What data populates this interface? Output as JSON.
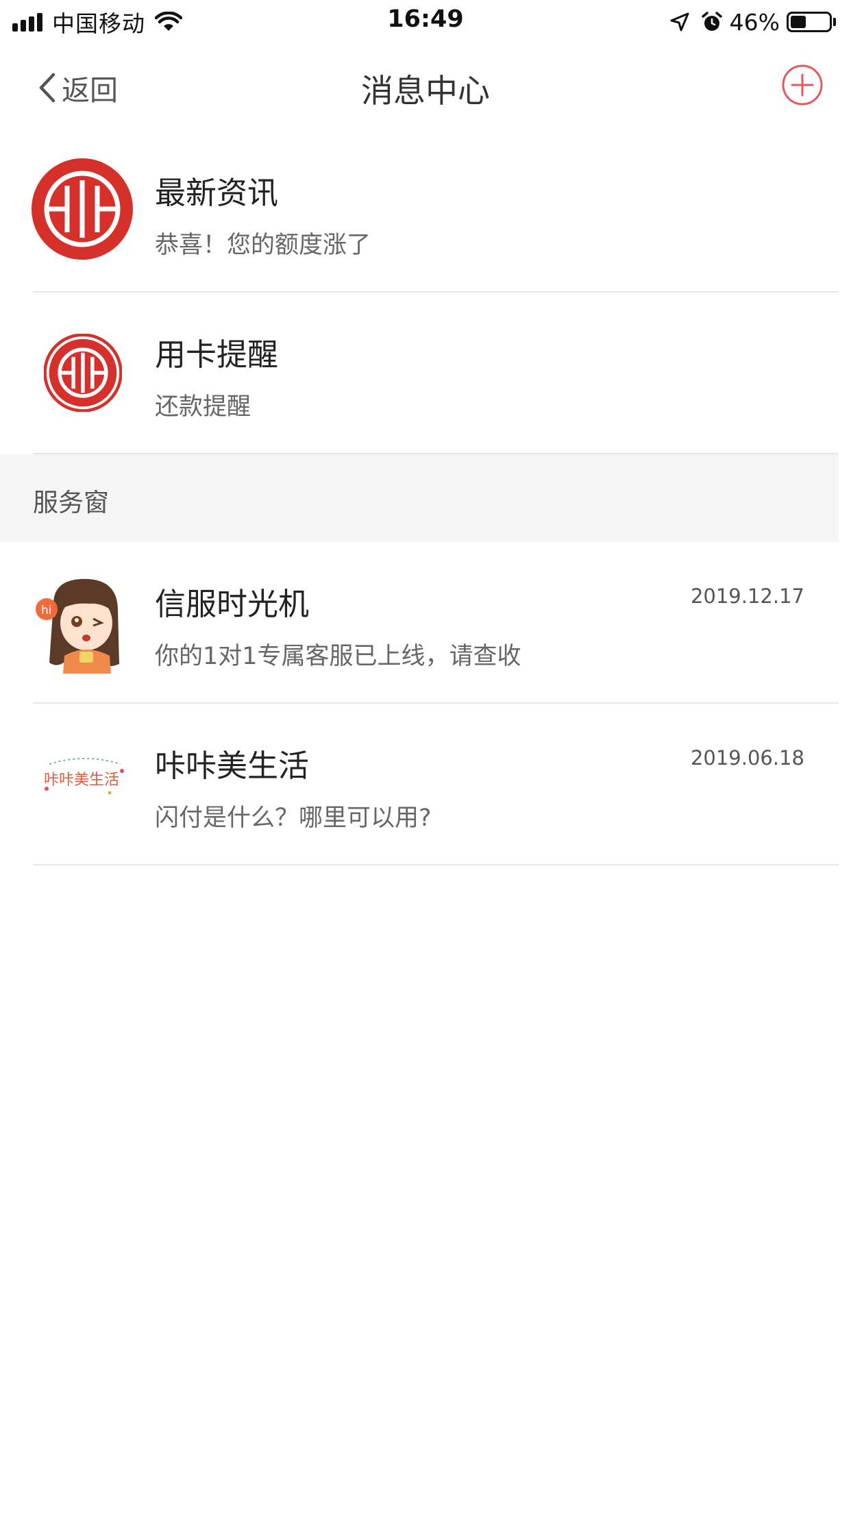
{
  "status_bar": {
    "carrier": "中国移动",
    "time": "16:49",
    "battery_percent": "46%",
    "battery_level": 0.46
  },
  "nav": {
    "back_label": "返回",
    "title": "消息中心"
  },
  "messages": [
    {
      "title": "最新资讯",
      "subtitle": "恭喜！您的额度涨了",
      "date": ""
    },
    {
      "title": "用卡提醒",
      "subtitle": "还款提醒",
      "date": ""
    }
  ],
  "section": {
    "label": "服务窗"
  },
  "services": [
    {
      "title": "信服时光机",
      "subtitle": "你的1对1专属客服已上线，请查收",
      "date": "2019.12.17",
      "badge": "hi"
    },
    {
      "title": "咔咔美生活",
      "subtitle": "闪付是什么？哪里可以用?",
      "date": "2019.06.18",
      "logo_text": "咔咔美生活"
    }
  ],
  "colors": {
    "brand_red": "#d6302a",
    "accent_add": "#e8585a",
    "section_bg": "#f5f5f5"
  },
  "icons": {
    "back": "chevron-left-icon",
    "add": "plus-circle-icon",
    "location": "location-arrow-icon",
    "alarm": "alarm-clock-icon",
    "wifi": "wifi-icon"
  }
}
